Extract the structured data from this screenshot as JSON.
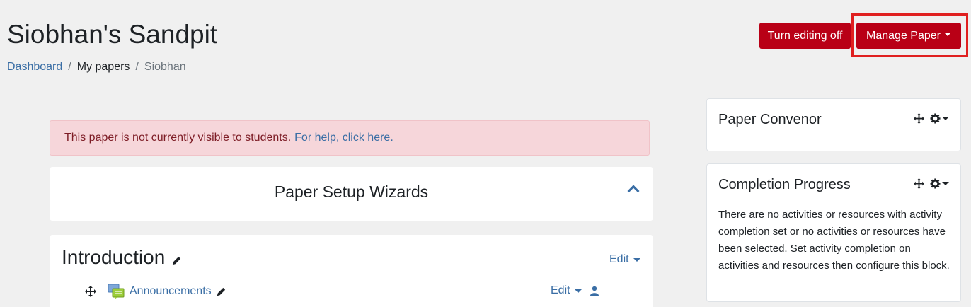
{
  "header": {
    "title": "Siobhan's Sandpit",
    "breadcrumb": [
      {
        "label": "Dashboard"
      },
      {
        "label": "My papers"
      },
      {
        "label": "Siobhan"
      }
    ],
    "separator": "/",
    "turn_editing_label": "Turn editing off",
    "manage_paper_label": "Manage Paper"
  },
  "alert": {
    "text": "This paper is not currently visible to students.",
    "link": "For help, click here."
  },
  "wizard": {
    "title": "Paper Setup Wizards"
  },
  "section": {
    "title": "Introduction",
    "edit_label": "Edit",
    "activity": {
      "name": "Announcements",
      "edit_label": "Edit"
    }
  },
  "blocks": {
    "convenor": {
      "title": "Paper Convenor"
    },
    "completion": {
      "title": "Completion Progress",
      "text": "There are no activities or resources with activity completion set or no activities or resources have been selected. Set activity completion on activities and resources then configure this block."
    }
  },
  "colors": {
    "accent_red": "#b90016",
    "link_blue": "#3a6ea5",
    "alert_bg": "#f6d6da",
    "highlight": "#e02020"
  }
}
